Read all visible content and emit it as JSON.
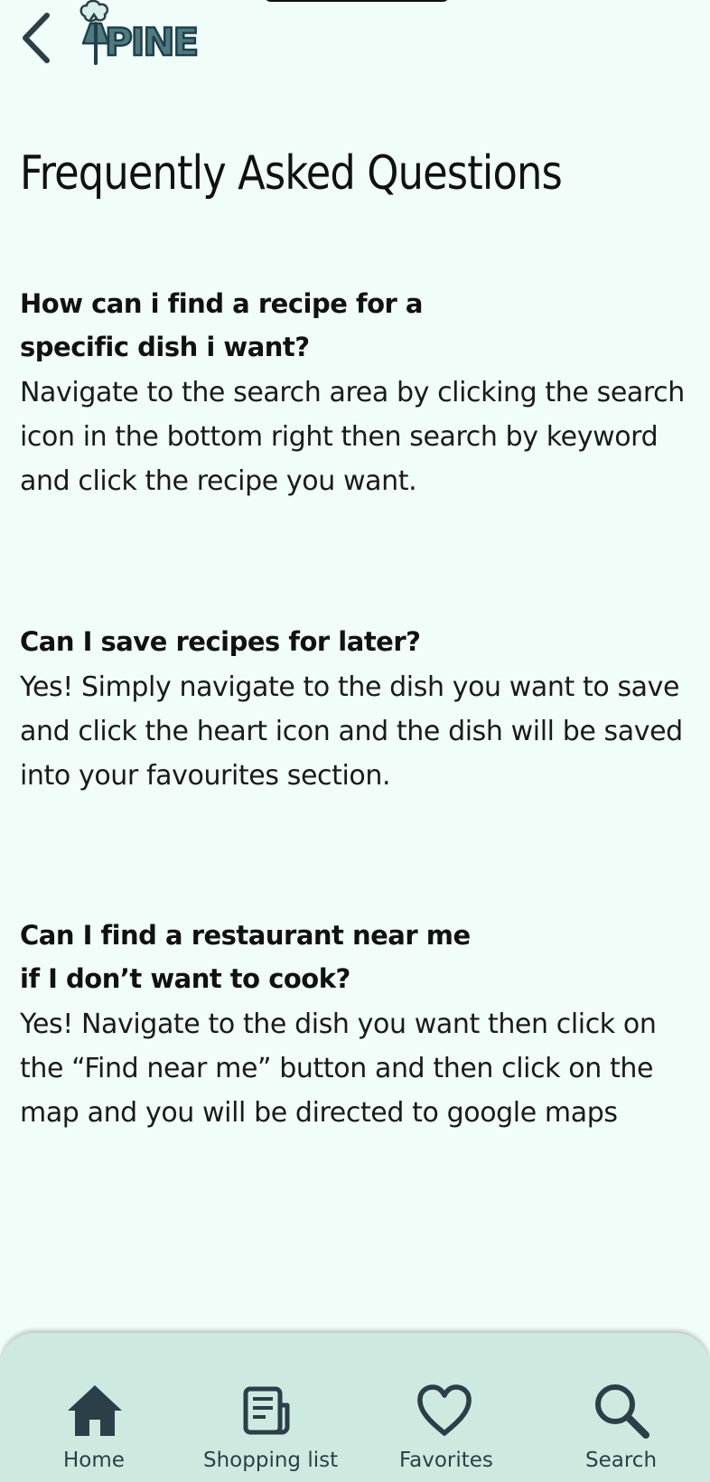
{
  "header": {
    "back_icon": "chevron-left-icon",
    "logo_text": "PINE",
    "logo_icon": "pine-tree-icon"
  },
  "page_title": "Frequently Asked Questions",
  "faqs": [
    {
      "question": "How can i find a recipe for a\nspecific dish i want?",
      "answer": "Navigate to the search area by clicking the search icon in the bottom right then search by keyword and click the recipe you want."
    },
    {
      "question": "Can I save recipes for later?",
      "answer": "Yes! Simply navigate to the dish you want to save and click the heart icon and the dish will be saved into your favourites section."
    },
    {
      "question": "Can I find a restaurant near me\nif I don’t want to cook?",
      "answer": "Yes! Navigate to the dish you want then click on the “Find near me” button and then click on the map and you will be directed to google maps"
    }
  ],
  "bottom_nav": {
    "items": [
      {
        "label": "Home",
        "icon": "home-icon"
      },
      {
        "label": "Shopping list",
        "icon": "list-icon"
      },
      {
        "label": "Favorites",
        "icon": "heart-icon"
      },
      {
        "label": "Search",
        "icon": "search-icon"
      }
    ]
  },
  "colors": {
    "background": "#f1fdf8",
    "nav_background": "#cde9e0",
    "icon_dark": "#2c3f48",
    "logo_fill": "#4f7a80"
  }
}
